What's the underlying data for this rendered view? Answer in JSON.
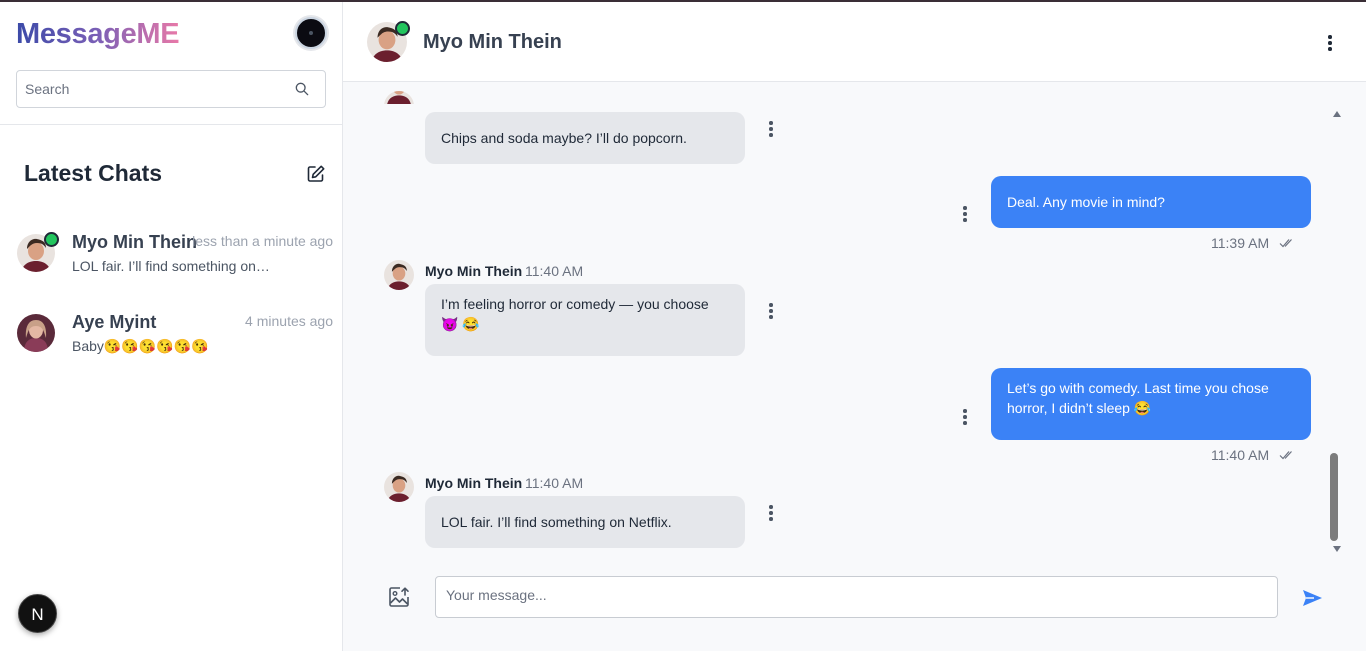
{
  "app": {
    "brand": "MessageME"
  },
  "search": {
    "placeholder": "Search"
  },
  "sidebar": {
    "title": "Latest Chats",
    "chats": [
      {
        "name": "Myo Min Thein",
        "time": "less than a minute ago",
        "preview": "LOL fair. I’ll find something on…",
        "online": true
      },
      {
        "name": "Aye Myint",
        "time": "4 minutes ago",
        "preview": "Baby😘😘😘😘😘😘",
        "online": false
      }
    ]
  },
  "badge": {
    "letter": "N"
  },
  "conversation": {
    "contact_name": "Myo Min Thein",
    "messages": [
      {
        "direction": "in",
        "text": "Chips and soda maybe? I’ll do popcorn."
      },
      {
        "direction": "out",
        "text": "Deal. Any movie in mind?",
        "time": "11:39 AM"
      },
      {
        "direction": "in",
        "sender": "Myo Min Thein",
        "time": "11:40 AM",
        "text": "I’m feeling horror or comedy — you choose 😈 😂"
      },
      {
        "direction": "out",
        "text": "Let’s go with comedy. Last time you chose horror, I didn’t sleep 😂",
        "time": "11:40 AM"
      },
      {
        "direction": "in",
        "sender": "Myo Min Thein",
        "time": "11:40 AM",
        "text": "LOL fair. I’ll find something on Netflix."
      }
    ]
  },
  "composer": {
    "placeholder": "Your message..."
  },
  "colors": {
    "accent": "#3b82f6",
    "online": "#22c55e",
    "incoming_bubble": "#e5e7eb"
  }
}
